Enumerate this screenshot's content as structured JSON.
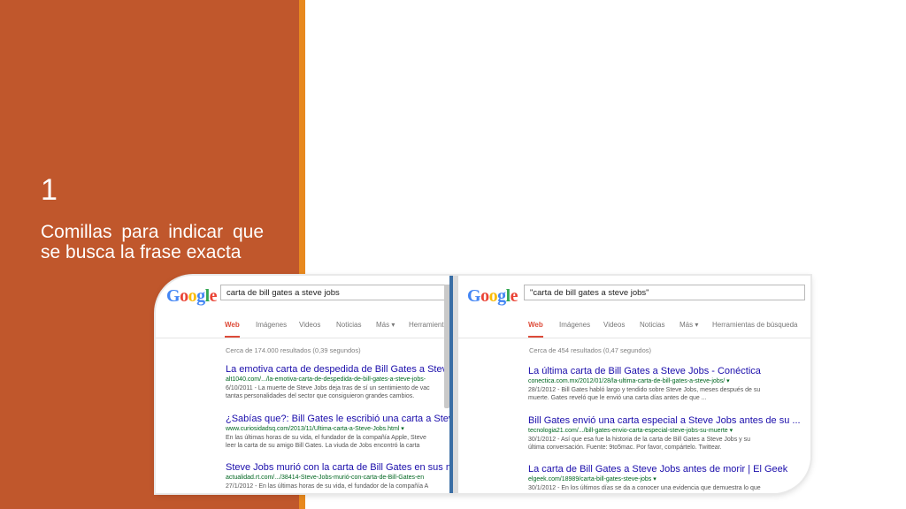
{
  "slide": {
    "number": "1",
    "text": "Comillas para indicar que se busca la frase exacta"
  },
  "left_browser": {
    "logo": "Google",
    "query": "carta de bill gates a steve jobs",
    "tabs": [
      "Web",
      "Imágenes",
      "Videos",
      "Noticias",
      "Más ▾",
      "Herramient"
    ],
    "stats": "Cerca de 174.000 resultados (0,39 segundos)",
    "results": [
      {
        "title": "La emotiva carta de despedida de Bill Gates a Steve",
        "url": "alt1040.com/.../la-emotiva-carta-de-despedida-de-bill-gates-a-steve-jobs-",
        "snippet1": "6/10/2011 - La muerte de Steve Jobs deja tras de sí un sentimiento de vac",
        "snippet2": "tantas personalidades del sector que consiguieron grandes cambios."
      },
      {
        "title": "¿Sabías que?: Bill Gates le escribió una carta a Stev",
        "url": "www.curiosidadsq.com/2013/11/Ultima-carta-a-Steve-Jobs.html ▾",
        "snippet1": "En las últimas horas de su vida, el fundador de la compañía Apple, Steve",
        "snippet2": "leer la carta de su amigo Bill Gates. La viuda de Jobs encontró la carta"
      },
      {
        "title": "Steve Jobs murió con la carta de Bill Gates en sus m",
        "url": "actualidad.rt.com/.../38414-Steve-Jobs-murió-con-carta-de-Bill-Gates-en",
        "snippet1": "27/1/2012 - En las últimas horas de su vida, el fundador de la compañía A",
        "snippet2": ""
      }
    ]
  },
  "right_browser": {
    "logo": "Google",
    "query": "\"carta de bill gates a steve jobs\"",
    "tabs": [
      "Web",
      "Imágenes",
      "Videos",
      "Noticias",
      "Más ▾",
      "Herramientas de búsqueda"
    ],
    "stats": "Cerca de 454 resultados (0,47 segundos)",
    "results": [
      {
        "title": "La última carta de Bill Gates a Steve Jobs - Conéctica",
        "url": "conectica.com.mx/2012/01/28/la-ultima-carta-de-bill-gates-a-steve-jobs/ ▾",
        "snippet1": "28/1/2012 - Bill Gates habló largo y tendido sobre Steve Jobs, meses después de su",
        "snippet2": "muerte. Gates reveló que le envió una carta días antes de que ..."
      },
      {
        "title": "Bill Gates envió una carta especial a Steve Jobs antes de su ...",
        "url": "tecnologia21.com/.../bill-gates-envio-carta-especial-steve-jobs-su-muerte ▾",
        "snippet1": "30/1/2012 - Así que esa fue la historia de la carta de Bill Gates a Steve Jobs y su",
        "snippet2": "última conversación. Fuente: 9to5mac. Por favor, compártelo. Twittear."
      },
      {
        "title": "La carta de Bill Gates a Steve Jobs antes de morir | El Geek",
        "url": "elgeek.com/18989/carta-bill-gates-steve-jobs ▾",
        "snippet1": "30/1/2012 - En los últimos días se da a conocer una evidencia que demuestra lo que",
        "snippet2": ""
      }
    ]
  },
  "colors": {
    "panel": "#c0572c",
    "accent": "#e8891e",
    "link": "#1a0dab",
    "url": "#006621",
    "active_tab": "#dd4b39"
  }
}
